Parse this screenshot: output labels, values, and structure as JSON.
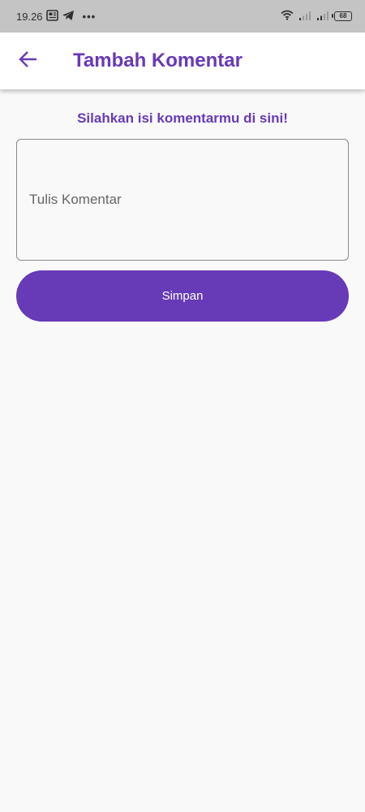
{
  "status_bar": {
    "time": "19.26",
    "notification_dots": "•••",
    "battery_level": "68",
    "icons": [
      "news-icon",
      "telegram-icon",
      "wifi-icon",
      "signal-icon",
      "signal-icon",
      "battery-icon"
    ]
  },
  "app_bar": {
    "title": "Tambah Komentar",
    "back_icon": "arrow-back-icon"
  },
  "form": {
    "prompt": "Silahkan isi komentarmu di sini!",
    "comment_placeholder": "Tulis Komentar",
    "comment_value": "",
    "save_label": "Simpan"
  },
  "colors": {
    "primary": "#673ab7",
    "background": "#f9f9f9",
    "status_bar": "#c4c4c4"
  }
}
